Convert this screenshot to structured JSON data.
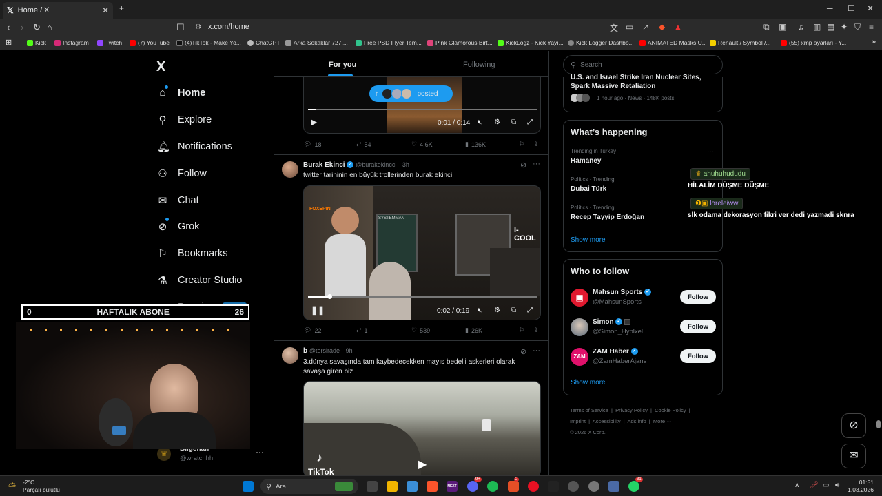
{
  "browser": {
    "tab_title": "Home / X",
    "url": "x.com/home",
    "bookmarks": [
      "Kick",
      "Instagram",
      "Twitch",
      "(7) YouTube",
      "(4)TikTok - Make Yo...",
      "ChatGPT",
      "Arka Sokaklar 727....",
      "Free PSD Flyer Tem...",
      "Pink Glamorous Birt...",
      "KickLogz - Kick Yayı...",
      "Kick Logger Dashbo...",
      "ANIMATED Masks U...",
      "Renault / Symbol /...",
      "(55) xmp ayarları - Y..."
    ]
  },
  "sidebar": {
    "logo": "X",
    "items": [
      {
        "label": "Home",
        "icon": "home-icon"
      },
      {
        "label": "Explore",
        "icon": "search-icon"
      },
      {
        "label": "Notifications",
        "icon": "bell-icon"
      },
      {
        "label": "Follow",
        "icon": "add-person-icon"
      },
      {
        "label": "Chat",
        "icon": "mail-icon"
      },
      {
        "label": "Grok",
        "icon": "grok-icon"
      },
      {
        "label": "Bookmarks",
        "icon": "bookmark-icon"
      },
      {
        "label": "Creator Studio",
        "icon": "flask-icon"
      },
      {
        "label": "Premium",
        "icon": "x-icon"
      }
    ],
    "premium_badge": "50% off",
    "account_name": "Bilgehan",
    "account_handle": "@wratchhh"
  },
  "overlay": {
    "left_count": "0",
    "title": "HAFTALIK ABONE",
    "right_count": "26"
  },
  "feed": {
    "tabs": [
      "For you",
      "Following"
    ],
    "posted_pill": "posted",
    "tweets": [
      {
        "video_time": "0:01 / 0:14",
        "replies": "18",
        "reposts": "54",
        "likes": "4.6K",
        "views": "136K"
      },
      {
        "name": "Burak Ekinci",
        "handle": "@burakekincci",
        "time": "3h",
        "text": "twitter tarihinin en büyük trollerinden burak ekinci",
        "video_time": "0:02 / 0:19",
        "replies": "22",
        "reposts": "1",
        "likes": "539",
        "views": "26K",
        "sign_text": "SYSTEMMAN",
        "sign_brand": "I-COOL",
        "sign_logo": "FOXEPIN"
      },
      {
        "name": "b",
        "handle": "@tersirade",
        "time": "9h",
        "text": "3.dünya savaşında tam kaybedecekken mayıs bedelli askerleri olarak savaşa giren biz",
        "watermark": "TikTok"
      }
    ]
  },
  "right": {
    "search_placeholder": "Search",
    "news_title": "U.S. and Israel Strike Iran Nuclear Sites, Spark Massive Retaliation",
    "news_meta": "1 hour ago · News · 148K posts",
    "whats_happening": "What’s happening",
    "trends": [
      {
        "cat": "Trending in Turkey",
        "name": "Hamaney"
      },
      {
        "cat": "Politics · Trending",
        "name": "Dubai Türk"
      },
      {
        "cat": "Politics · Trending",
        "name": "Recep Tayyip Erdoğan"
      }
    ],
    "show_more": "Show more",
    "who_to_follow": "Who to follow",
    "follow_label": "Follow",
    "suggestions": [
      {
        "name": "Mahsun Sports",
        "handle": "@MahsunSports"
      },
      {
        "name": "Simon",
        "handle": "@Simon_Hyplxel"
      },
      {
        "name": "ZAM Haber",
        "handle": "@ZamHaberAjans"
      }
    ],
    "avatar_text": "ZAM",
    "footer": [
      "Terms of Service",
      "Privacy Policy",
      "Cookie Policy",
      "Imprint",
      "Accessibility",
      "Ads info",
      "More ···",
      "© 2026 X Corp."
    ]
  },
  "chat": [
    {
      "user": "ahuhuhududu",
      "msg": "HİLALİM DÜŞME DÜŞME"
    },
    {
      "user": "loreleiww",
      "msg": "slk odama dekorasyon fikri ver dedi yazmadi sknra"
    }
  ],
  "taskbar": {
    "weather_temp": "-2°C",
    "weather_desc": "Parçalı bulutlu",
    "search_label": "Ara",
    "time": "01:51",
    "date": "1.03.2026",
    "badge_mail": "2",
    "badge_whatsapp": "31",
    "badge_discord": "9+",
    "next_label": "NEXT"
  },
  "colors": {
    "accent": "#1d9bf0",
    "bg": "#000000",
    "border": "#2f3336"
  }
}
